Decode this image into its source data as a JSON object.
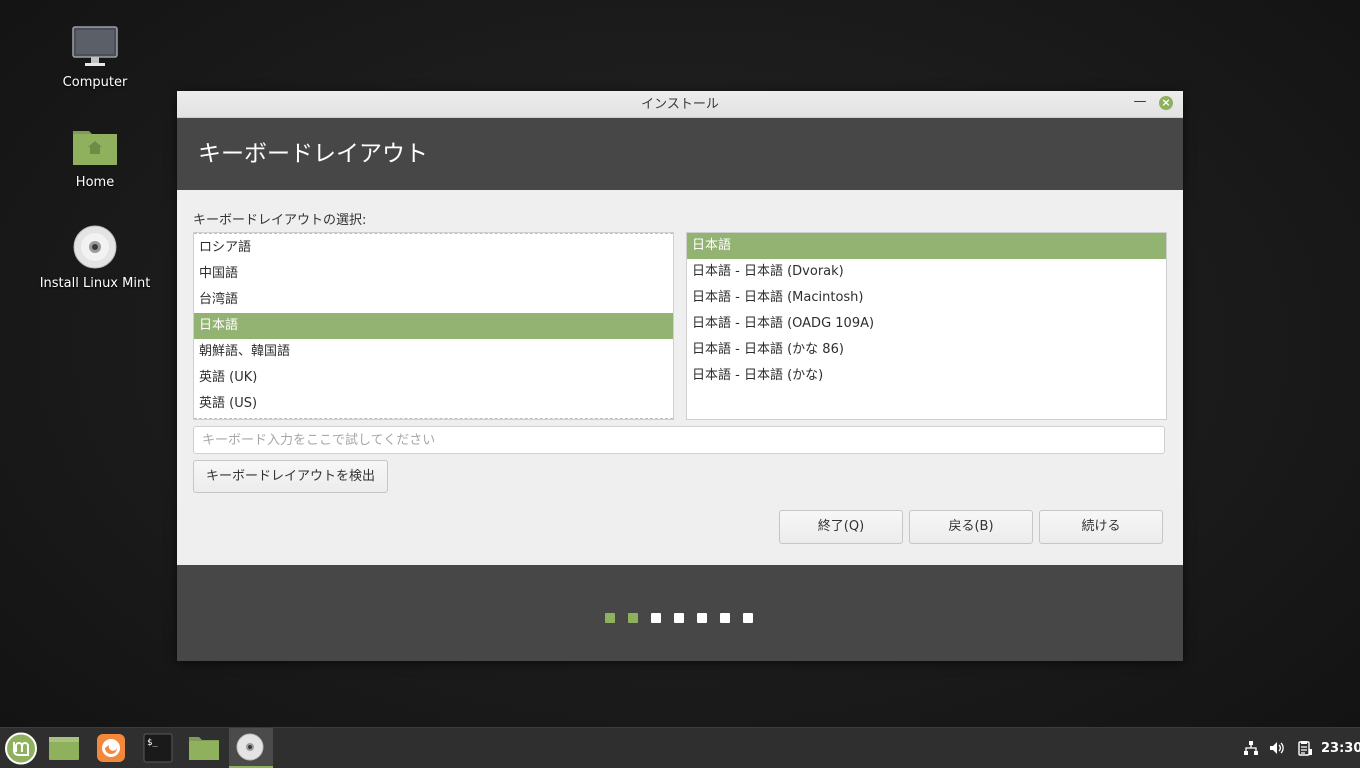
{
  "desktop": {
    "icons": [
      {
        "label": "Computer"
      },
      {
        "label": "Home"
      },
      {
        "label": "Install Linux Mint"
      }
    ]
  },
  "window": {
    "title": "インストール",
    "header": "キーボードレイアウト",
    "select_label": "キーボードレイアウトの選択:",
    "layouts_left": [
      {
        "label": "ロシア語",
        "selected": false
      },
      {
        "label": "中国語",
        "selected": false
      },
      {
        "label": "台湾語",
        "selected": false
      },
      {
        "label": "日本語",
        "selected": true
      },
      {
        "label": "朝鮮語、韓国語",
        "selected": false
      },
      {
        "label": "英語 (UK)",
        "selected": false
      },
      {
        "label": "英語 (US)",
        "selected": false
      }
    ],
    "variants_right": [
      {
        "label": "日本語",
        "selected": true
      },
      {
        "label": "日本語 - 日本語 (Dvorak)",
        "selected": false
      },
      {
        "label": "日本語 - 日本語 (Macintosh)",
        "selected": false
      },
      {
        "label": "日本語 - 日本語 (OADG 109A)",
        "selected": false
      },
      {
        "label": "日本語 - 日本語 (かな 86)",
        "selected": false
      },
      {
        "label": "日本語 - 日本語 (かな)",
        "selected": false
      }
    ],
    "test_input": {
      "value": "",
      "placeholder": "キーボード入力をここで試してください"
    },
    "detect_button": "キーボードレイアウトを検出",
    "buttons": {
      "quit": "終了(Q)",
      "back": "戻る(B)",
      "next": "続ける"
    },
    "progress": {
      "completed_steps": 2,
      "total_steps": 7
    }
  },
  "taskbar": {
    "clock": "23:30"
  },
  "colors": {
    "accent": "#8fb15d",
    "header_band": "#474747",
    "selection": "#93b372"
  }
}
